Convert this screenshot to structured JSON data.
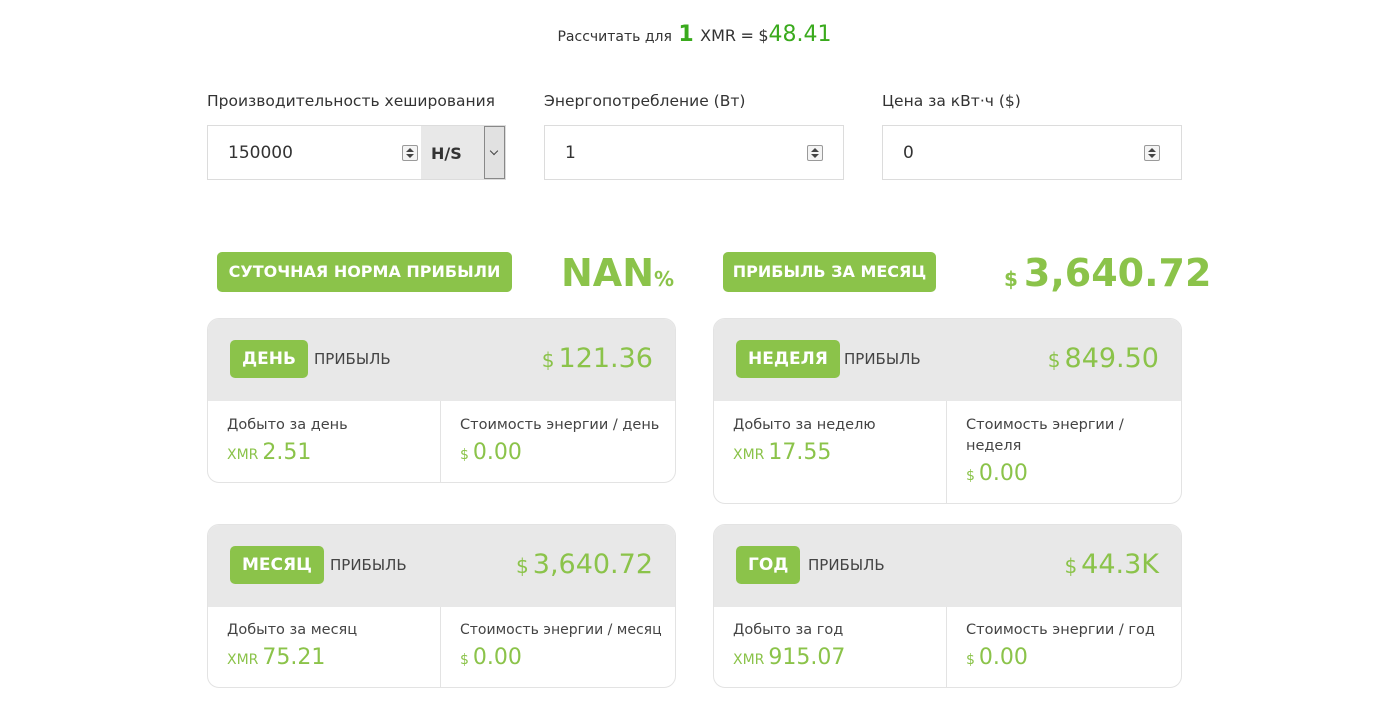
{
  "rate": {
    "prefix": "Рассчитать для",
    "amount": "1",
    "coin": "XMR",
    "equals": "=",
    "currency": "$",
    "price": "48.41"
  },
  "inputs": {
    "hashrate": {
      "label": "Производительность хеширования",
      "value": "150000",
      "unit": "H/S"
    },
    "power": {
      "label": "Энергопотребление (Вт)",
      "value": "1"
    },
    "cost": {
      "label": "Цена за кВт·ч ($)",
      "value": "0"
    }
  },
  "summary": {
    "daily_rate": {
      "label": "СУТОЧНАЯ НОРМА ПРИБЫЛИ",
      "value": "NAN",
      "unit": "%"
    },
    "monthly": {
      "label": "ПРИБЫЛЬ ЗА МЕСЯЦ",
      "currency": "$",
      "value": "3,640.72"
    }
  },
  "profit_word": "ПРИБЫЛЬ",
  "coin_unit": "XMR",
  "currency": "$",
  "cards": {
    "day": {
      "period": "ДЕНЬ",
      "profit": "121.36",
      "mined_label": "Добыто за день",
      "mined": "2.51",
      "energy_label": "Стоимость энергии / день",
      "energy": "0.00"
    },
    "week": {
      "period": "НЕДЕЛЯ",
      "profit": "849.50",
      "mined_label": "Добыто за неделю",
      "mined": "17.55",
      "energy_label": "Стоимость энергии / неделя",
      "energy": "0.00"
    },
    "month": {
      "period": "МЕСЯЦ",
      "profit": "3,640.72",
      "mined_label": "Добыто за месяц",
      "mined": "75.21",
      "energy_label": "Стоимость энергии / месяц",
      "energy": "0.00"
    },
    "year": {
      "period": "ГОД",
      "profit": "44.3K",
      "mined_label": "Добыто за год",
      "mined": "915.07",
      "energy_label": "Стоимость энергии / год",
      "energy": "0.00"
    }
  },
  "colors": {
    "accent": "#8bc34a",
    "rate_green": "#3aaa1d",
    "panel": "#e8e8e8"
  }
}
